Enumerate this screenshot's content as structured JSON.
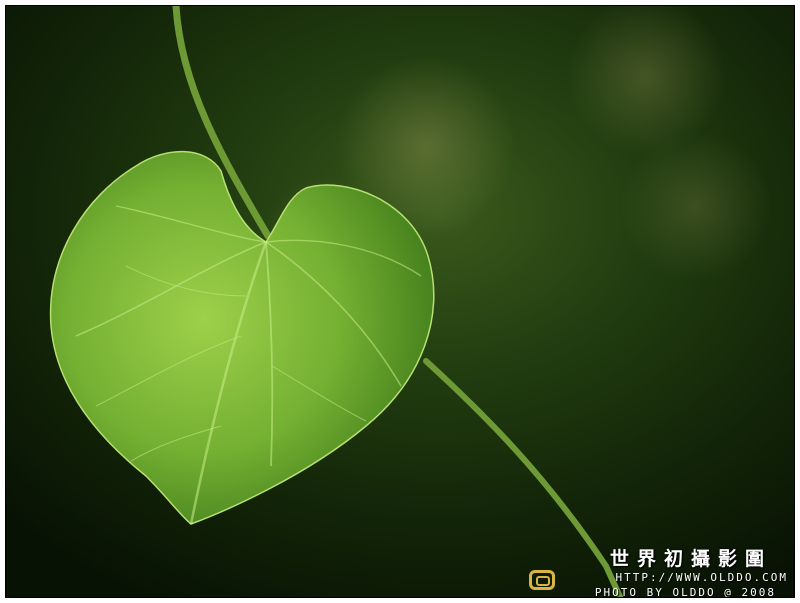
{
  "photo": {
    "subject": "leaf-on-vine",
    "colors": {
      "background_dark": "#0d1a08",
      "background_mid": "#2c4a14",
      "leaf_light": "#8cc63c",
      "leaf_dark": "#3f7a1a",
      "stem": "#6e9a36"
    }
  },
  "watermark": {
    "title": "世界初攝影圍",
    "url": "HTTP://WWW.OLDDO.COM",
    "credit": "PHOTO BY OLDDO @ 2008",
    "logo_icon": "olddo-logo-icon",
    "logo_color": "#d8b640"
  }
}
